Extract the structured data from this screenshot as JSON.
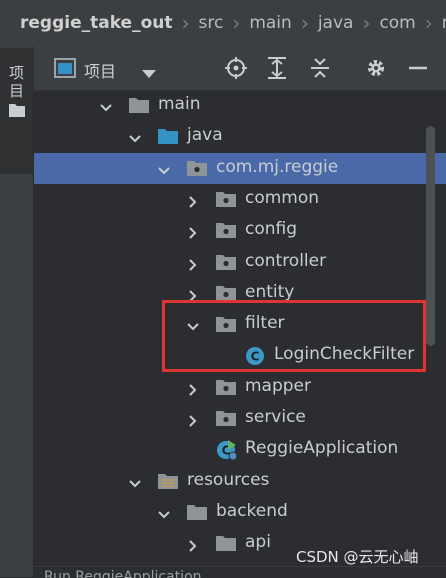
{
  "breadcrumb": {
    "items": [
      "reggie_take_out",
      "src",
      "main",
      "java",
      "com",
      "mj"
    ]
  },
  "side": {
    "project_label": "项目"
  },
  "toolbar": {
    "title": "项目"
  },
  "tree": {
    "rows": [
      {
        "label": "main",
        "indent": 0,
        "chevron": "down",
        "icon": "folder-gray",
        "selected": false
      },
      {
        "label": "java",
        "indent": 1,
        "chevron": "down",
        "icon": "folder-blue",
        "selected": false
      },
      {
        "label": "com.mj.reggie",
        "indent": 2,
        "chevron": "down",
        "icon": "package",
        "selected": true
      },
      {
        "label": "common",
        "indent": 3,
        "chevron": "right",
        "icon": "package",
        "selected": false
      },
      {
        "label": "config",
        "indent": 3,
        "chevron": "right",
        "icon": "package",
        "selected": false
      },
      {
        "label": "controller",
        "indent": 3,
        "chevron": "right",
        "icon": "package",
        "selected": false
      },
      {
        "label": "entity",
        "indent": 3,
        "chevron": "right",
        "icon": "package",
        "selected": false
      },
      {
        "label": "filter",
        "indent": 3,
        "chevron": "down",
        "icon": "package",
        "selected": false
      },
      {
        "label": "LoginCheckFilter",
        "indent": 4,
        "chevron": "none",
        "icon": "class",
        "selected": false
      },
      {
        "label": "mapper",
        "indent": 3,
        "chevron": "right",
        "icon": "package",
        "selected": false
      },
      {
        "label": "service",
        "indent": 3,
        "chevron": "right",
        "icon": "package",
        "selected": false
      },
      {
        "label": "ReggieApplication",
        "indent": 3,
        "chevron": "none",
        "icon": "spring-class",
        "selected": false
      },
      {
        "label": "resources",
        "indent": 1,
        "chevron": "down",
        "icon": "folder-resources",
        "selected": false
      },
      {
        "label": "backend",
        "indent": 2,
        "chevron": "down",
        "icon": "folder-gray",
        "selected": false
      },
      {
        "label": "api",
        "indent": 3,
        "chevron": "right",
        "icon": "folder-gray",
        "selected": false
      }
    ]
  },
  "bottom": {
    "text": "Run   ReggieApplication"
  },
  "watermark": {
    "text": "CSDN @云无心岫"
  }
}
